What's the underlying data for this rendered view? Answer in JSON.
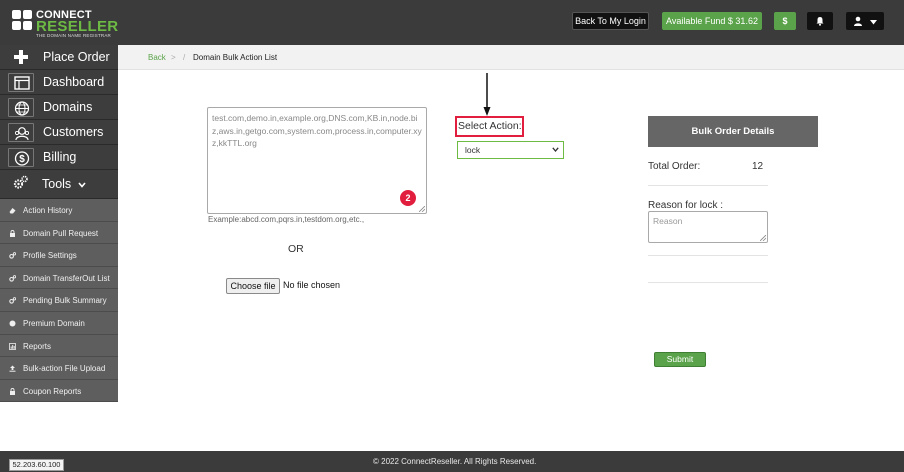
{
  "header": {
    "logo_line1": "CONNECT",
    "logo_line2": "RESELLER",
    "logo_tagline": "THE DOMAIN NAME REGISTRAR",
    "back_to_login": "Back To My Login",
    "available_fund": "Available Fund  $ 31.62",
    "dollar_button": "$",
    "bell_icon": "bell-icon",
    "user_icon": "user-icon"
  },
  "sidebar": {
    "items": [
      {
        "label": "Place Order",
        "icon": "plus-icon"
      },
      {
        "label": "Dashboard",
        "icon": "dashboard-icon"
      },
      {
        "label": "Domains",
        "icon": "globe-icon"
      },
      {
        "label": "Customers",
        "icon": "customers-icon"
      },
      {
        "label": "Billing",
        "icon": "dollar-circle-icon"
      },
      {
        "label": "Tools",
        "icon": "gears-icon"
      }
    ],
    "tools_items": [
      {
        "label": "Action History",
        "icon": "eraser-icon"
      },
      {
        "label": "Domain Pull Request",
        "icon": "lock-icon"
      },
      {
        "label": "Profile Settings",
        "icon": "gears-icon"
      },
      {
        "label": "Domain TransferOut List",
        "icon": "gears-icon"
      },
      {
        "label": "Pending Bulk Summary",
        "icon": "gears-icon"
      },
      {
        "label": "Premium Domain",
        "icon": "globe-icon"
      },
      {
        "label": "Reports",
        "icon": "bar-chart-icon"
      },
      {
        "label": "Bulk-action File Upload",
        "icon": "upload-icon"
      },
      {
        "label": "Coupon Reports",
        "icon": "lock-icon"
      }
    ]
  },
  "breadcrumb": {
    "back": "Back",
    "separator1": ">",
    "separator2": "/",
    "current": "Domain Bulk Action List"
  },
  "form": {
    "domains_value": "test.com,demo.in,example.org,DNS.com,KB.in,node.biz,aws.in,getgo.com,system.com,process.in,computer.xyz,kkTTL.org",
    "badge_count": "2",
    "example": "Example:abcd.com,pqrs.in,testdom.org,etc.,",
    "or": "OR",
    "choose_file": "Choose file",
    "file_status": "No file chosen",
    "select_action_label": "Select Action:",
    "select_action_value": "lock"
  },
  "panel": {
    "title": "Bulk Order Details",
    "total_order_label": "Total Order:",
    "total_order_value": "12",
    "reason_label": "Reason for lock :",
    "reason_placeholder": "Reason",
    "submit": "Submit"
  },
  "footer": {
    "ip": "52.203.60.100",
    "copyright": "© 2022 ConnectReseller. All Rights Reserved."
  },
  "colors": {
    "header_bg": "#3b3b3b",
    "accent_green": "#5ba34a",
    "highlight_red": "#e21e3f",
    "panel_gray": "#666666"
  }
}
